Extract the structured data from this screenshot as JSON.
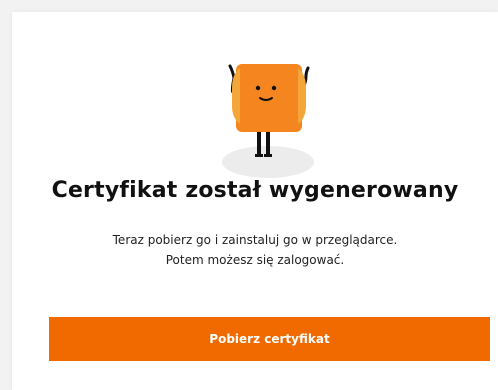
{
  "confirmation": {
    "title": "Certyfikat został wygenerowany",
    "description_line1": "Teraz pobierz go i zainstaluj go w przeglądarce.",
    "description_line2": "Potem możesz się zalogować.",
    "download_button_label": "Pobierz certyfikat"
  },
  "colors": {
    "accent": "#f06a00",
    "mascot_body": "#f5861f",
    "mascot_side": "#f3a73a"
  },
  "icons": {
    "mascot": "waving-orange-square-mascot"
  }
}
